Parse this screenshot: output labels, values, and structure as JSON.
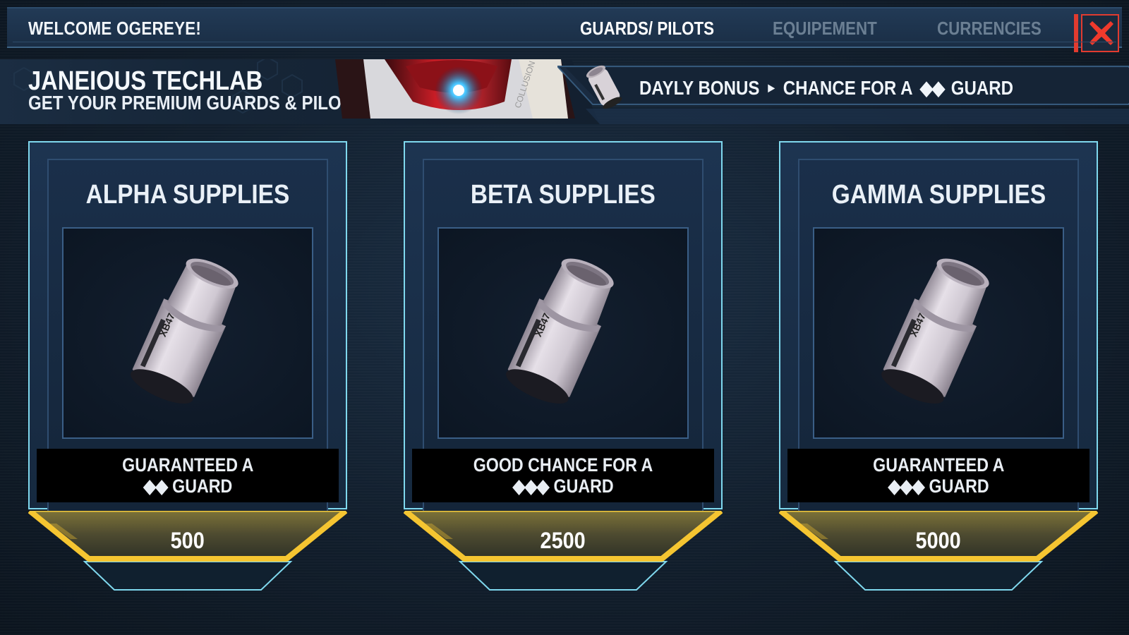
{
  "topbar": {
    "welcome": "WELCOME OGEREYE!",
    "tabs": [
      {
        "label": "GUARDS/ PILOTS",
        "active": true
      },
      {
        "label": "EQUIPEMENT",
        "active": false
      },
      {
        "label": "CURRENCIES",
        "active": false
      }
    ],
    "close_icon": "close-x-icon"
  },
  "banner": {
    "title": "JANEIOUS TECHLAB",
    "subtitle": "GET YOUR PREMIUM GUARDS & PILOTS HERE",
    "daily_bonus": {
      "label": "DAYLY BONUS",
      "chance_prefix": "CHANCE FOR A",
      "gems": "◆◆",
      "suffix": "GUARD"
    }
  },
  "cards": [
    {
      "title": "ALPHA SUPPLIES",
      "line1": "GUARANTEED A",
      "gems": "◆◆",
      "line2": "GUARD",
      "price": "500",
      "canister_label": "XB47"
    },
    {
      "title": "BETA SUPPLIES",
      "line1": "GOOD CHANCE FOR A",
      "gems": "◆◆◆",
      "line2": "GUARD",
      "price": "2500",
      "canister_label": "XB47"
    },
    {
      "title": "GAMMA SUPPLIES",
      "line1": "GUARANTEED A",
      "gems": "◆◆◆",
      "line2": "GUARD",
      "price": "5000",
      "canister_label": "XB47"
    }
  ],
  "colors": {
    "accent_gold": "#f5c531",
    "frame_cyan": "#7fd8ee",
    "close_red": "#e23b2f",
    "inactive_tab": "#6b7f93"
  }
}
